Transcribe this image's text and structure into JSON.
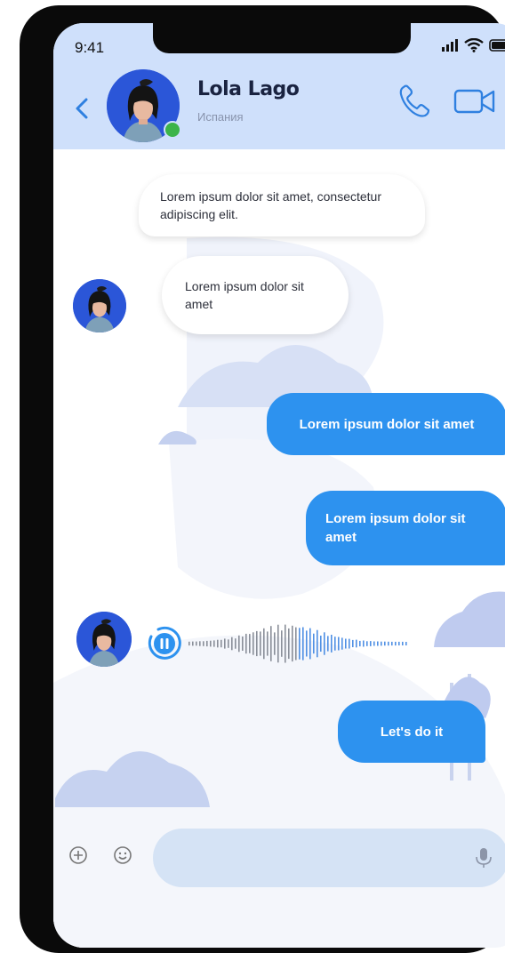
{
  "status_bar": {
    "time": "9:41"
  },
  "header": {
    "contact_name": "Lola Lago",
    "contact_subtitle": "Испания",
    "online": true,
    "icons": [
      "back-chevron-icon",
      "phone-icon",
      "video-camera-icon"
    ]
  },
  "messages": [
    {
      "direction": "incoming",
      "text": "Lorem ipsum dolor sit amet, consectetur adipiscing elit."
    },
    {
      "direction": "incoming",
      "text": "Lorem ipsum dolor sit amet"
    },
    {
      "direction": "outgoing",
      "text": "Lorem ipsum dolor sit amet"
    },
    {
      "direction": "outgoing",
      "text": "Lorem ipsum dolor sit amet"
    },
    {
      "direction": "incoming",
      "type": "voice",
      "state": "playing"
    },
    {
      "direction": "outgoing",
      "text": "Let's do it"
    }
  ],
  "composer": {
    "placeholder": "",
    "icons": [
      "plus-icon",
      "emoji-icon",
      "microphone-icon"
    ]
  },
  "colors": {
    "header_bg": "#cfe0fb",
    "accent_blue": "#2d92ef",
    "icon_blue": "#2f80e0",
    "online_green": "#3cb449",
    "input_bg": "#d5e3f5"
  }
}
